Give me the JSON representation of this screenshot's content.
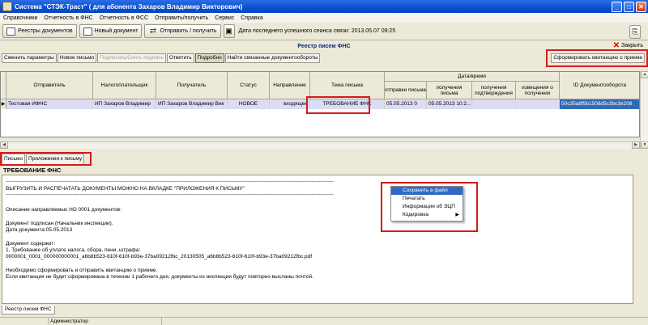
{
  "window": {
    "title": "Система \"СТЭК-Траст\" ( для абонента Захаров Владимир Викторович)"
  },
  "menu": [
    "Справочники",
    "Отчетность в ФНС",
    "Отчетность в ФСС",
    "Отправить/получить",
    "Сервис",
    "Справка"
  ],
  "toolbar": {
    "registries": "Реестры документов",
    "new_document": "Новый документ",
    "send_receive": "Отправить / получить",
    "last_session": "Дата последнего успешного сеанса связи: 2013.05.07 09:25"
  },
  "panel": {
    "title": "Реестр писем ФНС",
    "close": "Закрыть"
  },
  "actions": {
    "change_params": "Сменить параметры",
    "new_letter": "Новое письмо",
    "sign": "Подписать/Снять подпись",
    "reply": "Ответить",
    "details": "Подробно",
    "find_related": "Найти связанные документообороты",
    "generate_receipt": "Сформировать квитанцию о приеме"
  },
  "table": {
    "columns": {
      "sender": "Отправитель",
      "taxpayer": "Налогоплательщик",
      "recipient": "Получатель",
      "status": "Статус",
      "direction": "Направление",
      "subject": "Тема письма",
      "datetime": "Дата/время",
      "sent": "отправки письма",
      "received": "получения письма",
      "confirm_received": "получения подтверждения",
      "notice_received": "извещения о получении",
      "doc_id": "ID Документооборота"
    },
    "row": {
      "sender": "Тестовая ИФНС",
      "taxpayer": "ИП Захаров Владимир",
      "recipient": "ИП Захаров Владимир Вик",
      "status": "НОВОЕ",
      "direction": "входящее",
      "subject": "ТРЕБОВАНИЕ ФНС",
      "sent": "05.05.2013 0",
      "received": "05.05.2013 10:2...",
      "confirm_received": "",
      "notice_received": "",
      "doc_id": "50c35a8f5b1508d5c3bc3e208"
    }
  },
  "tabs": [
    "Письмо",
    "Приложения к письму"
  ],
  "letter": {
    "title": "ТРЕБОВАНИЕ ФНС",
    "dashes": "---------------------------------------------------------------------------------------------------------------------------------------------------------------------------------------------------------------------------------",
    "line1": "ВЫГРУЗИТЬ И РАСПЕЧАТАТЬ ДОКУМЕНТЫ МОЖНО НА ВКЛАДКЕ \"ПРИЛОЖЕНИЯ К ПИСЬМУ\"",
    "line2": "Описание направляемых НО 0001 документов:",
    "line3": "Документ подписан (Начальник инспекции).",
    "line4": "Дата документа:05.05.2013",
    "line5": "Документ содержит:",
    "line6": "1. Требование об уплате налога, сбора, пени, штрафа:",
    "line7": "0000001_0001_000000000001_a6b8b523-610f-610f-b93e-37ba09212fbc_20130505_a6b8b523-610f-610f-b93e-37ba09212fbc.pdf",
    "line8": "Необходимо сформировать и отправить квитанцию о приеме.",
    "line9": "Если квитанция не будет сформирована в течении 1 рабочего дня, документы из инспекции будут повторно высланы почтой."
  },
  "context_menu": [
    "Сохранить в файл",
    "Печатать",
    "Информация об ЭЦП",
    "Кодировка"
  ],
  "bottom_tab": "Реестр писем ФНС",
  "status_user": "Администратор"
}
